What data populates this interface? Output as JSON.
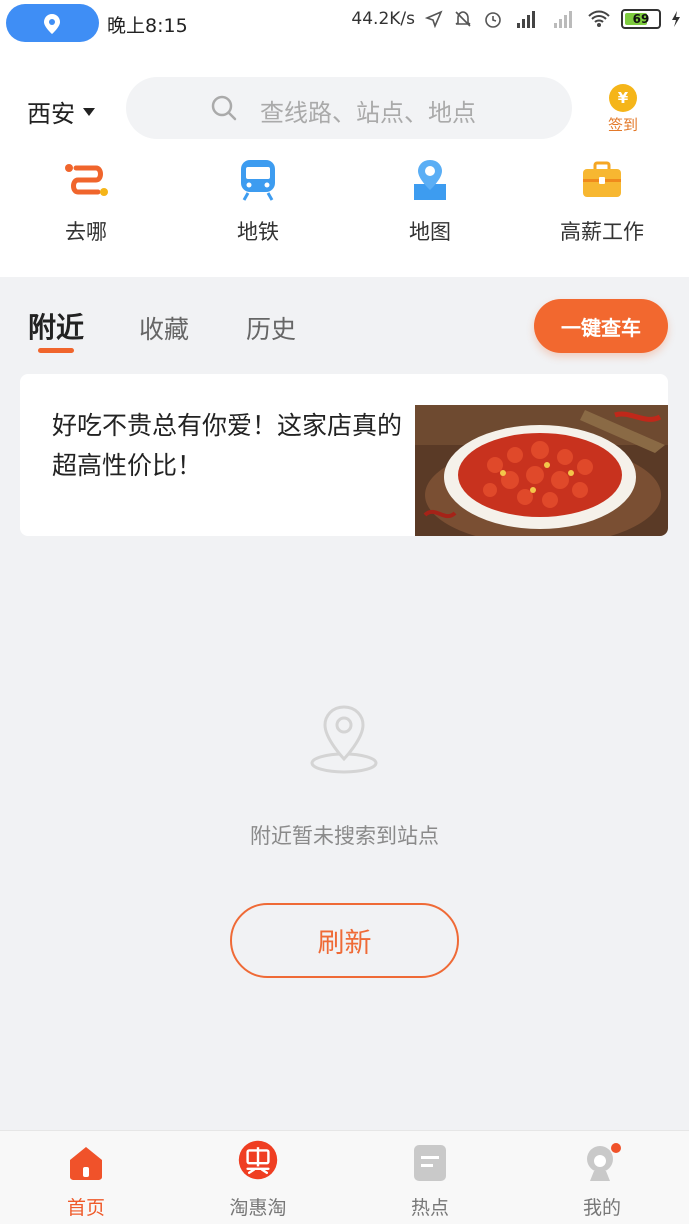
{
  "status_bar": {
    "time": "晚上8:15",
    "network_speed": "44.2K/s",
    "battery": "69"
  },
  "header": {
    "city": "西安",
    "search_placeholder": "查线路、站点、地点",
    "signin_label": "签到",
    "coin_symbol": "¥"
  },
  "quick_entries": [
    {
      "label": "去哪",
      "icon": "route-icon"
    },
    {
      "label": "地铁",
      "icon": "subway-icon"
    },
    {
      "label": "地图",
      "icon": "map-icon"
    },
    {
      "label": "高薪工作",
      "icon": "briefcase-icon"
    }
  ],
  "tabs": [
    "附近",
    "收藏",
    "历史"
  ],
  "one_key_check": "一键查车",
  "ad": {
    "text": "好吃不贵总有你爱！这家店真的超高性价比！"
  },
  "empty_state": {
    "message": "附近暂未搜索到站点",
    "refresh": "刷新"
  },
  "bottom_nav": [
    {
      "label": "首页",
      "active": true
    },
    {
      "label": "淘惠淘",
      "active": false
    },
    {
      "label": "热点",
      "active": false
    },
    {
      "label": "我的",
      "active": false
    }
  ],
  "colors": {
    "accent": "#f2682f",
    "location_pill": "#3f8ef5"
  }
}
